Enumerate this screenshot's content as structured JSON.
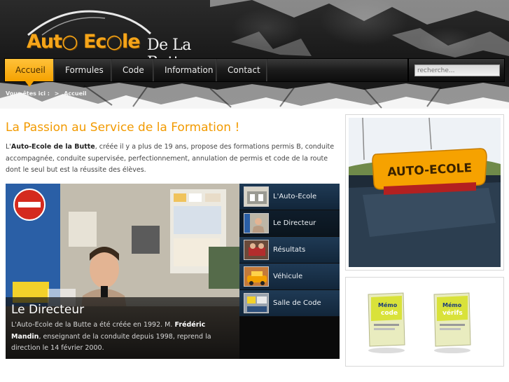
{
  "brand": {
    "logo_main": "Aut○ Ec○le",
    "logo_sub": "De La Butte",
    "accent_color": "#f5a200"
  },
  "nav": {
    "items": [
      {
        "label": "Accueil",
        "active": true
      },
      {
        "label": "Formules",
        "active": false
      },
      {
        "label": "Code",
        "active": false
      },
      {
        "label": "Information",
        "active": false
      },
      {
        "label": "Contact",
        "active": false
      }
    ],
    "search_placeholder": "recherche..."
  },
  "breadcrumb": {
    "prefix": "Vous êtes ici :",
    "separator": ">",
    "current": "Accueil"
  },
  "main": {
    "title": "La Passion au Service de la Formation !",
    "intro_pre": "L'",
    "intro_bold": "Auto-Ecole de la Butte",
    "intro_post": ", créée il y a plus de 19 ans, propose des formations permis B, conduite accompagnée, conduite supervisée, perfectionnement, annulation de permis et code de la route                dont le seul but est la réussite des élèves."
  },
  "slider": {
    "caption_title": "Le Directeur",
    "caption_pre": "L'Auto-Ecole de la Butte a été créée en 1992. M. ",
    "caption_bold": "Frédéric Mandin",
    "caption_post": ", enseignant de la conduite depuis 1998, reprend la direction le 14 février 2000.",
    "items": [
      {
        "label": "L'Auto-Ecole",
        "thumb": "building-thumbnail"
      },
      {
        "label": "Le Directeur",
        "thumb": "director-thumbnail"
      },
      {
        "label": "Résultats",
        "thumb": "results-thumbnail"
      },
      {
        "label": "Véhicule",
        "thumb": "vehicle-thumbnail"
      },
      {
        "label": "Salle de Code",
        "thumb": "classroom-thumbnail"
      }
    ],
    "active_index": 1
  },
  "sidebar": {
    "sign_text": "AUTO-ECOLE",
    "memo1_line1": "Mémo",
    "memo1_line2": "code",
    "memo2_line1": "Mémo",
    "memo2_line2": "vérifs"
  }
}
